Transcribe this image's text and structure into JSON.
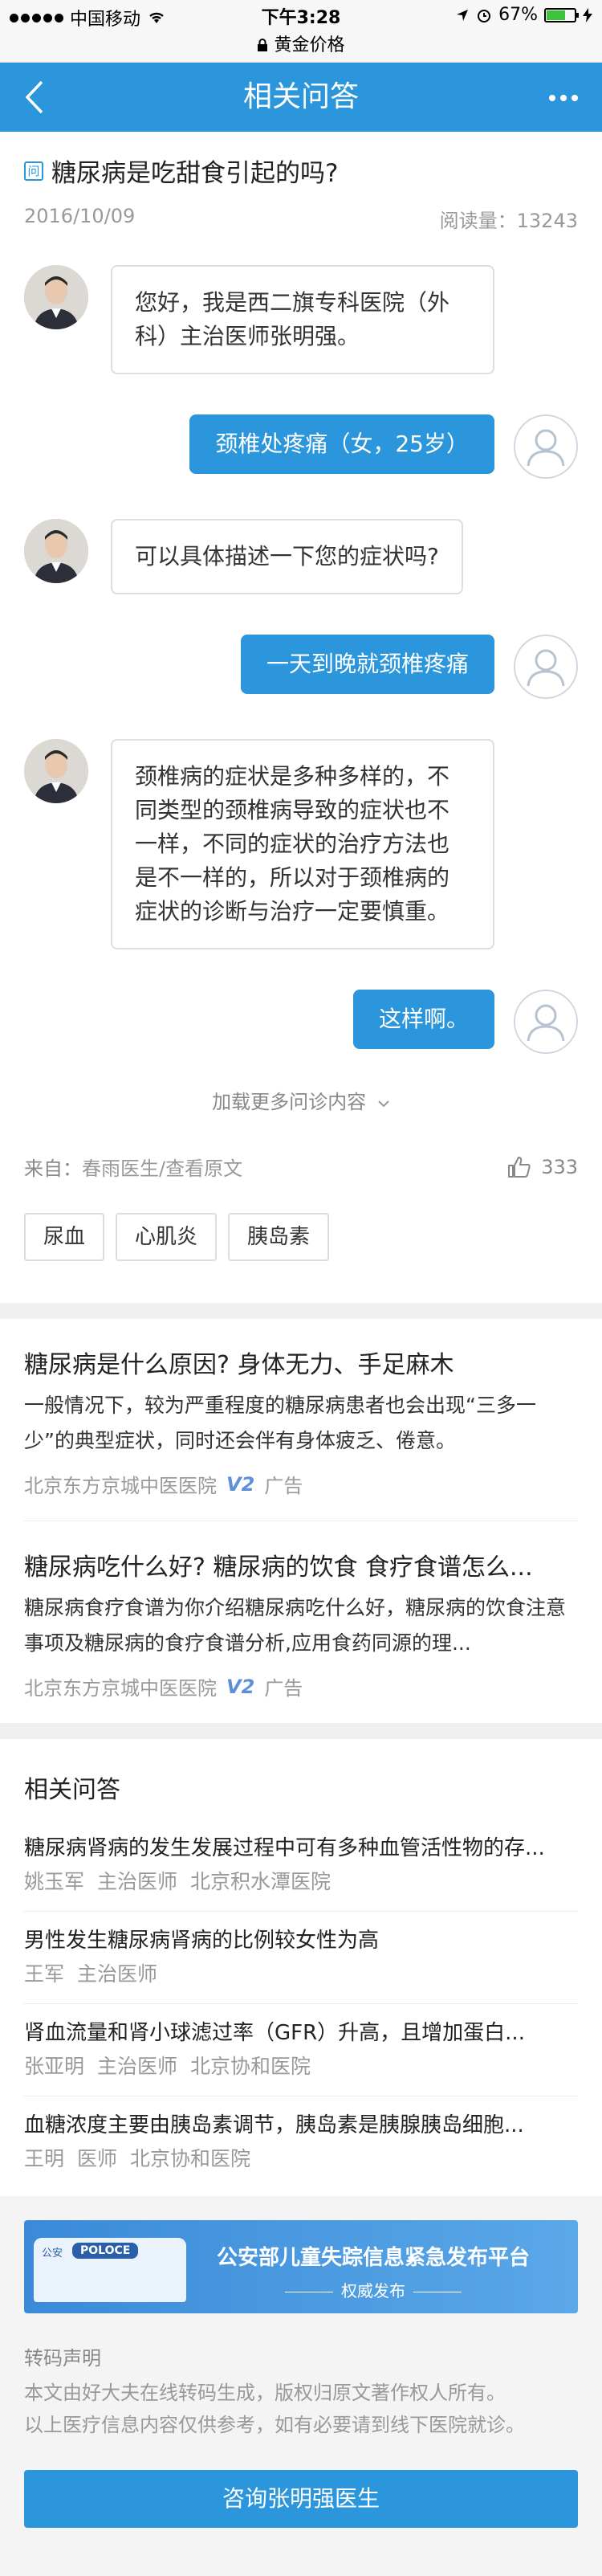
{
  "status": {
    "carrier": "中国移动",
    "time": "下午3:28",
    "battery": "67%",
    "battery_level": 0.67
  },
  "url_bar": "黄金价格",
  "nav": {
    "title": "相关问答"
  },
  "question": {
    "tag": "问",
    "title": "糖尿病是吃甜食引起的吗?",
    "date": "2016/10/09",
    "views": "阅读量：13243"
  },
  "messages": [
    {
      "side": "left",
      "text": "您好，我是西二旗专科医院（外科）主治医师张明强。"
    },
    {
      "side": "right",
      "text": "颈椎处疼痛（女，25岁）"
    },
    {
      "side": "left",
      "text": "可以具体描述一下您的症状吗?"
    },
    {
      "side": "right",
      "text": "一天到晚就颈椎疼痛"
    },
    {
      "side": "left",
      "text": "颈椎病的症状是多种多样的，不同类型的颈椎病导致的症状也不一样，不同的症状的治疗方法也是不一样的，所以对于颈椎病的症状的诊断与治疗一定要慎重。"
    },
    {
      "side": "right",
      "text": "这样啊。"
    }
  ],
  "load_more": "加载更多问诊内容",
  "source": {
    "prefix": "来自：",
    "link": "春雨医生/查看原文",
    "likes": "333"
  },
  "tags": [
    "尿血",
    "心肌炎",
    "胰岛素"
  ],
  "ads": [
    {
      "title": "糖尿病是什么原因? 身体无力、手足麻木",
      "desc": "一般情况下，较为严重程度的糖尿病患者也会出现“三多一少”的典型症状，同时还会伴有身体疲乏、倦意。",
      "source": "北京东方京城中医医院",
      "badge": "V2",
      "label": "广告"
    },
    {
      "title": "糖尿病吃什么好? 糖尿病的饮食 食疗食谱怎么...",
      "desc": "糖尿病食疗食谱为你介绍糖尿病吃什么好，糖尿病的饮食注意事项及糖尿病的食疗食谱分析,应用食药同源的理...",
      "source": "北京东方京城中医医院",
      "badge": "V2",
      "label": "广告"
    }
  ],
  "related": {
    "title": "相关问答",
    "items": [
      {
        "q": "糖尿病肾病的发生发展过程中可有多种血管活性物的存...",
        "name": "姚玉军",
        "role": "主治医师",
        "hospital": "北京积水潭医院"
      },
      {
        "q": "男性发生糖尿病肾病的比例较女性为高",
        "name": "王军",
        "role": "主治医师",
        "hospital": ""
      },
      {
        "q": "肾血流量和肾小球滤过率（GFR）升高，且增加蛋白...",
        "name": "张亚明",
        "role": "主治医师",
        "hospital": "北京协和医院"
      },
      {
        "q": "血糖浓度主要由胰岛素调节，胰岛素是胰腺胰岛细胞...",
        "name": "王明",
        "role": "医师",
        "hospital": "北京协和医院"
      }
    ]
  },
  "banner": {
    "car_text": "公安",
    "car_badge": "POLOCE",
    "title": "公安部儿童失踪信息紧急发布平台",
    "sub": "权威发布"
  },
  "notice": {
    "title": "转码声明",
    "line1": "本文由好大夫在线转码生成，版权归原文著作权人所有。",
    "line2": "以上医疗信息内容仅供参考，如有必要请到线下医院就诊。"
  },
  "cta": "咨询张明强医生"
}
